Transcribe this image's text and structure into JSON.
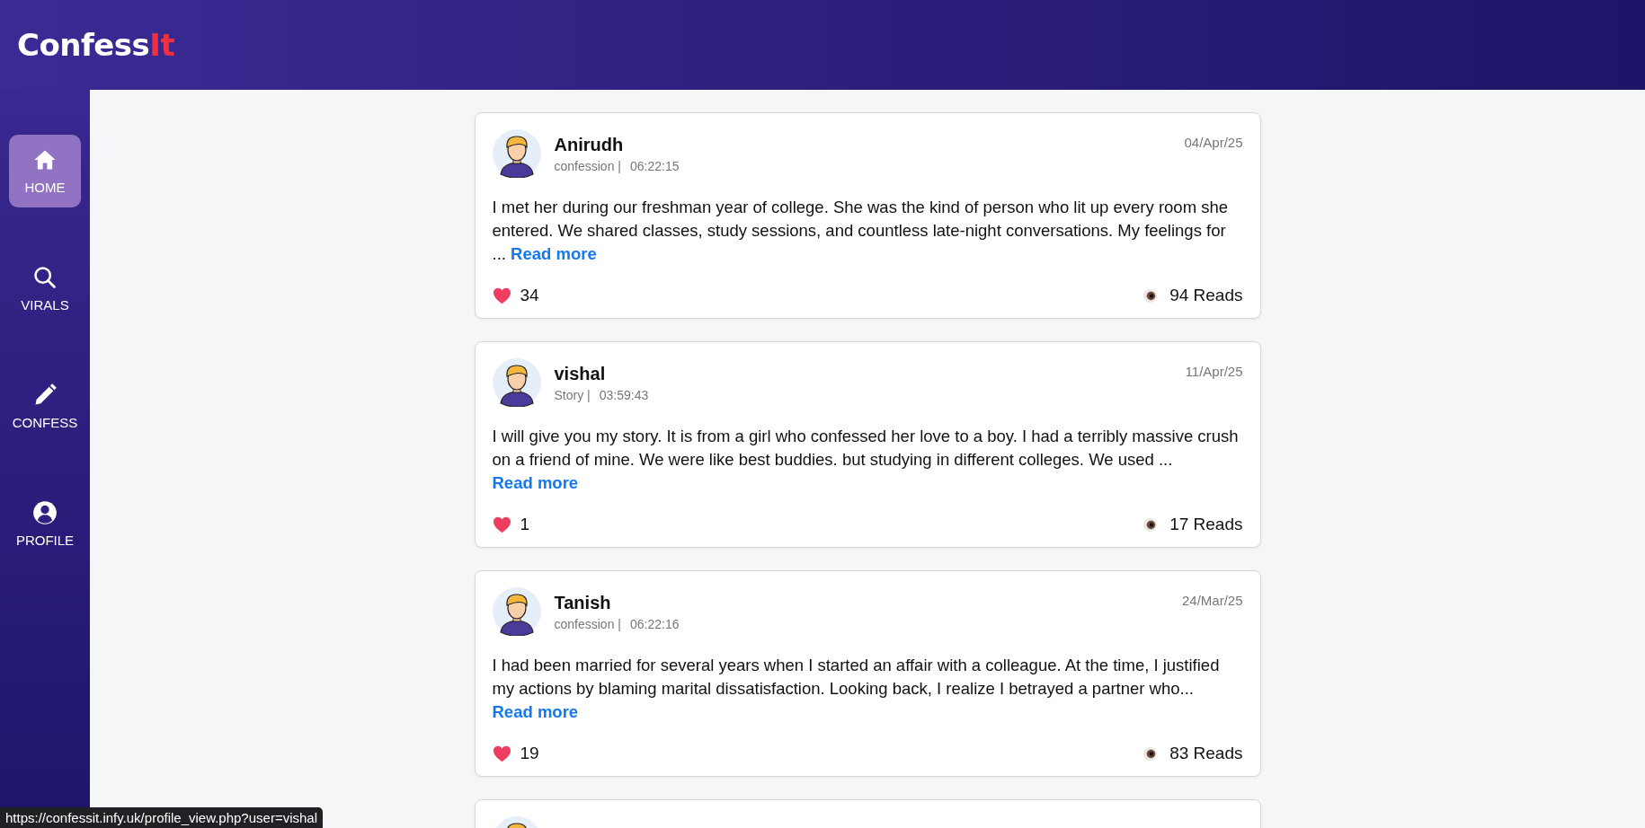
{
  "logo": {
    "main": "Confess",
    "accent": "It"
  },
  "nav": [
    {
      "label": "HOME",
      "selected": true
    },
    {
      "label": "VIRALS",
      "selected": false
    },
    {
      "label": "CONFESS",
      "selected": false
    },
    {
      "label": "PROFILE",
      "selected": false
    }
  ],
  "posts": [
    {
      "kind": "full",
      "author": "Anirudh",
      "category": "confession |",
      "time": "06:22:15",
      "date": "04/Apr/25",
      "text": "I met her during our freshman year of college. She was the kind of person who lit up every room she entered. We shared classes, study sessions, and countless late-night conversations. My feelings for ...",
      "read_more": "Read more",
      "likes": "34",
      "reads": "94 Reads"
    },
    {
      "kind": "full",
      "author": "vishal",
      "category": "Story |",
      "time": "03:59:43",
      "date": "11/Apr/25",
      "text": "I will give you my story. It is from a girl who confessed her love to a boy. I had a terribly massive crush on a friend of mine. We were like best buddies. but studying in different colleges. We used ...",
      "read_more": "Read more",
      "likes": "1",
      "reads": "17 Reads"
    },
    {
      "kind": "full",
      "author": "Tanish",
      "category": "confession |",
      "time": "06:22:16",
      "date": "24/Mar/25",
      "text": "I had been married for several years when I started an affair with a colleague. At the time, I justified my actions by blaming marital dissatisfaction. Looking back, I realize I betrayed a partner who...",
      "read_more": "Read more",
      "likes": "19",
      "reads": "83 Reads"
    },
    {
      "kind": "partial"
    }
  ],
  "status_url": "https://confessit.infy.uk/profile_view.php?user=vishal"
}
